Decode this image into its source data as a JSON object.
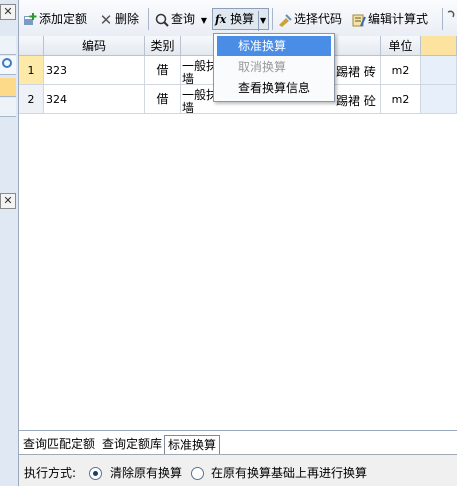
{
  "toolbar": {
    "add_quota": "添加定额",
    "delete": "删除",
    "query": "查询",
    "convert": "换算",
    "select_code": "选择代码",
    "edit_formula": "编辑计算式"
  },
  "convert_menu": {
    "items": [
      "标准换算",
      "取消换算",
      "查看换算信息"
    ],
    "highlighted_index": 0,
    "disabled_index": 1
  },
  "grid": {
    "columns": [
      "编码",
      "类别",
      "单位"
    ],
    "rows": [
      {
        "num": "1",
        "code": "323",
        "type": "借",
        "name_left": "一般抹",
        "name_left2": "墙",
        "name_right": "踢裙 砖",
        "unit": "m2"
      },
      {
        "num": "2",
        "code": "324",
        "type": "借",
        "name_left": "一般抹",
        "name_left2": "墙",
        "name_right": "踢裙 砼",
        "unit": "m2"
      }
    ]
  },
  "bottom_tabs": [
    "查询匹配定额",
    "查询定额库",
    "标准换算"
  ],
  "execution": {
    "label": "执行方式:",
    "option1": "清除原有换算",
    "option2": "在原有换算基础上再进行换算"
  },
  "colors": {
    "menu_highlight": "#4a8de6",
    "selected_row_number": "#fde9a8"
  }
}
